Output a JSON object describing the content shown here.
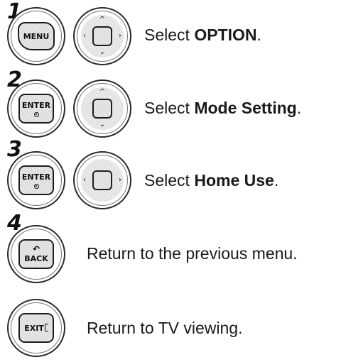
{
  "steps": [
    {
      "number": "1",
      "button": "MENU",
      "dpad": "left-right-up-down",
      "prefix": "Select ",
      "bold": "OPTION",
      "suffix": "."
    },
    {
      "number": "2",
      "button": "ENTER",
      "dpad": "up-down",
      "prefix": "Select ",
      "bold": "Mode Setting",
      "suffix": "."
    },
    {
      "number": "3",
      "button": "ENTER",
      "dpad": "left-right",
      "prefix": "Select ",
      "bold": "Home Use",
      "suffix": "."
    },
    {
      "number": "4",
      "button": "BACK",
      "text": "Return to the previous menu."
    },
    {
      "button": "EXIT",
      "text": "Return to TV viewing."
    }
  ],
  "icons": [
    "menu-button-icon",
    "navigation-pad-icon",
    "enter-button-icon",
    "back-button-icon",
    "exit-button-icon"
  ]
}
